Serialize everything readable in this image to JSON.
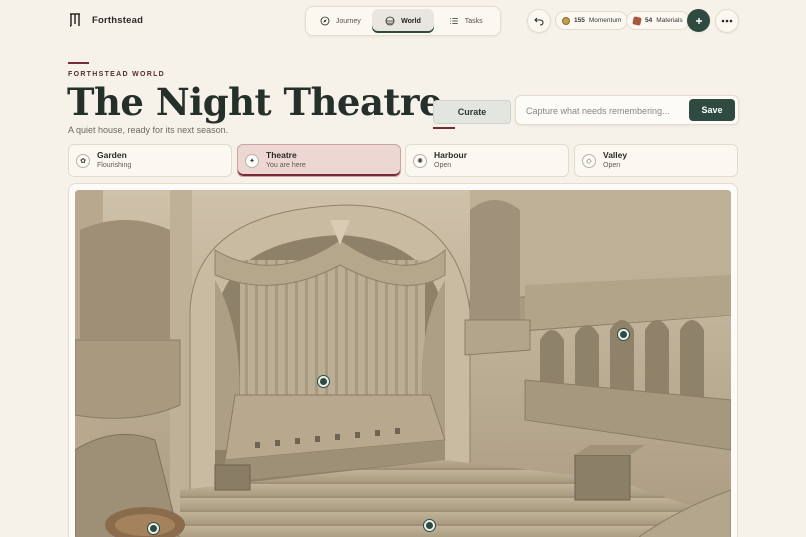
{
  "brand": {
    "name": "Forthstead",
    "logo_icon": "forthstead-mark-icon"
  },
  "nav": {
    "tabs": [
      {
        "label": "Journey",
        "icon": "compass-icon",
        "active": false
      },
      {
        "label": "World",
        "icon": "globe-icon",
        "active": true
      },
      {
        "label": "Tasks",
        "icon": "list-icon",
        "active": false
      }
    ]
  },
  "toolbar": {
    "undo_icon": "undo-icon",
    "momentum": {
      "value": "155",
      "label": "Momentum"
    },
    "materials": {
      "value": "54",
      "label": "Materials"
    },
    "add_icon": "plus-icon",
    "more_icon": "more-icon"
  },
  "header": {
    "eyebrow": "FORTHSTEAD WORLD",
    "title": "The Night Theatre",
    "subtitle": "A quiet house, ready for its next season."
  },
  "actions": {
    "curate_label": "Curate",
    "capture_placeholder": "Capture what needs remembering...",
    "capture_value": "",
    "save_label": "Save"
  },
  "locations": [
    {
      "name": "Garden",
      "status": "Flourishing",
      "icon": "flower-icon",
      "active": false
    },
    {
      "name": "Theatre",
      "status": "You are here",
      "icon": "sparkle-icon",
      "active": true
    },
    {
      "name": "Harbour",
      "status": "Open",
      "icon": "sun-icon",
      "active": false
    },
    {
      "name": "Valley",
      "status": "Open",
      "icon": "diamond-icon",
      "active": false
    }
  ],
  "colors": {
    "accent": "#2f4a40",
    "wine": "#7a2a35",
    "background": "#f6f2e9"
  }
}
